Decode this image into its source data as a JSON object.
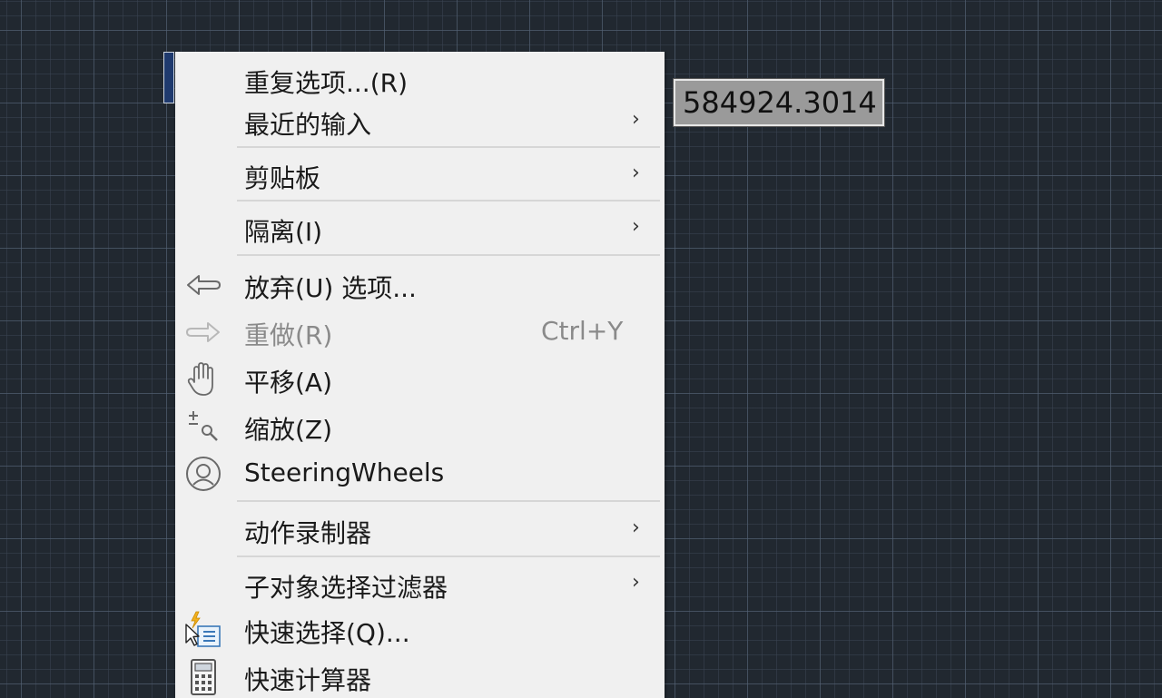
{
  "coord_tooltip": {
    "value": "584924.3014"
  },
  "menu": {
    "items": [
      {
        "label": "重复选项...(R)",
        "icon": "",
        "shortcut": "",
        "submenu": false
      },
      {
        "label": "最近的输入",
        "icon": "",
        "shortcut": "",
        "submenu": true,
        "arrow": "›"
      },
      {
        "label": "剪贴板",
        "icon": "",
        "shortcut": "",
        "submenu": true,
        "arrow": "›"
      },
      {
        "label": "隔离(I)",
        "icon": "",
        "shortcut": "",
        "submenu": true,
        "arrow": "›"
      },
      {
        "label": "放弃(U) 选项...",
        "icon": "undo-icon",
        "shortcut": "",
        "submenu": false
      },
      {
        "label": "重做(R)",
        "icon": "redo-icon",
        "shortcut": "Ctrl+Y",
        "submenu": false,
        "disabled": true
      },
      {
        "label": "平移(A)",
        "icon": "pan-hand-icon",
        "shortcut": "",
        "submenu": false
      },
      {
        "label": "缩放(Z)",
        "icon": "zoom-icon",
        "shortcut": "",
        "submenu": false
      },
      {
        "label": "SteeringWheels",
        "icon": "steering-wheel-icon",
        "shortcut": "",
        "submenu": false
      },
      {
        "label": "动作录制器",
        "icon": "",
        "shortcut": "",
        "submenu": true,
        "arrow": "›"
      },
      {
        "label": "子对象选择过滤器",
        "icon": "",
        "shortcut": "",
        "submenu": true,
        "arrow": "›"
      },
      {
        "label": "快速选择(Q)...",
        "icon": "quick-select-icon",
        "shortcut": "",
        "submenu": false
      },
      {
        "label": "快速计算器",
        "icon": "calculator-icon",
        "shortcut": "",
        "submenu": false
      }
    ]
  },
  "colors": {
    "canvas_background": "#212830",
    "menu_background": "#f0f0f0",
    "tooltip_background": "#9a9a9a"
  }
}
